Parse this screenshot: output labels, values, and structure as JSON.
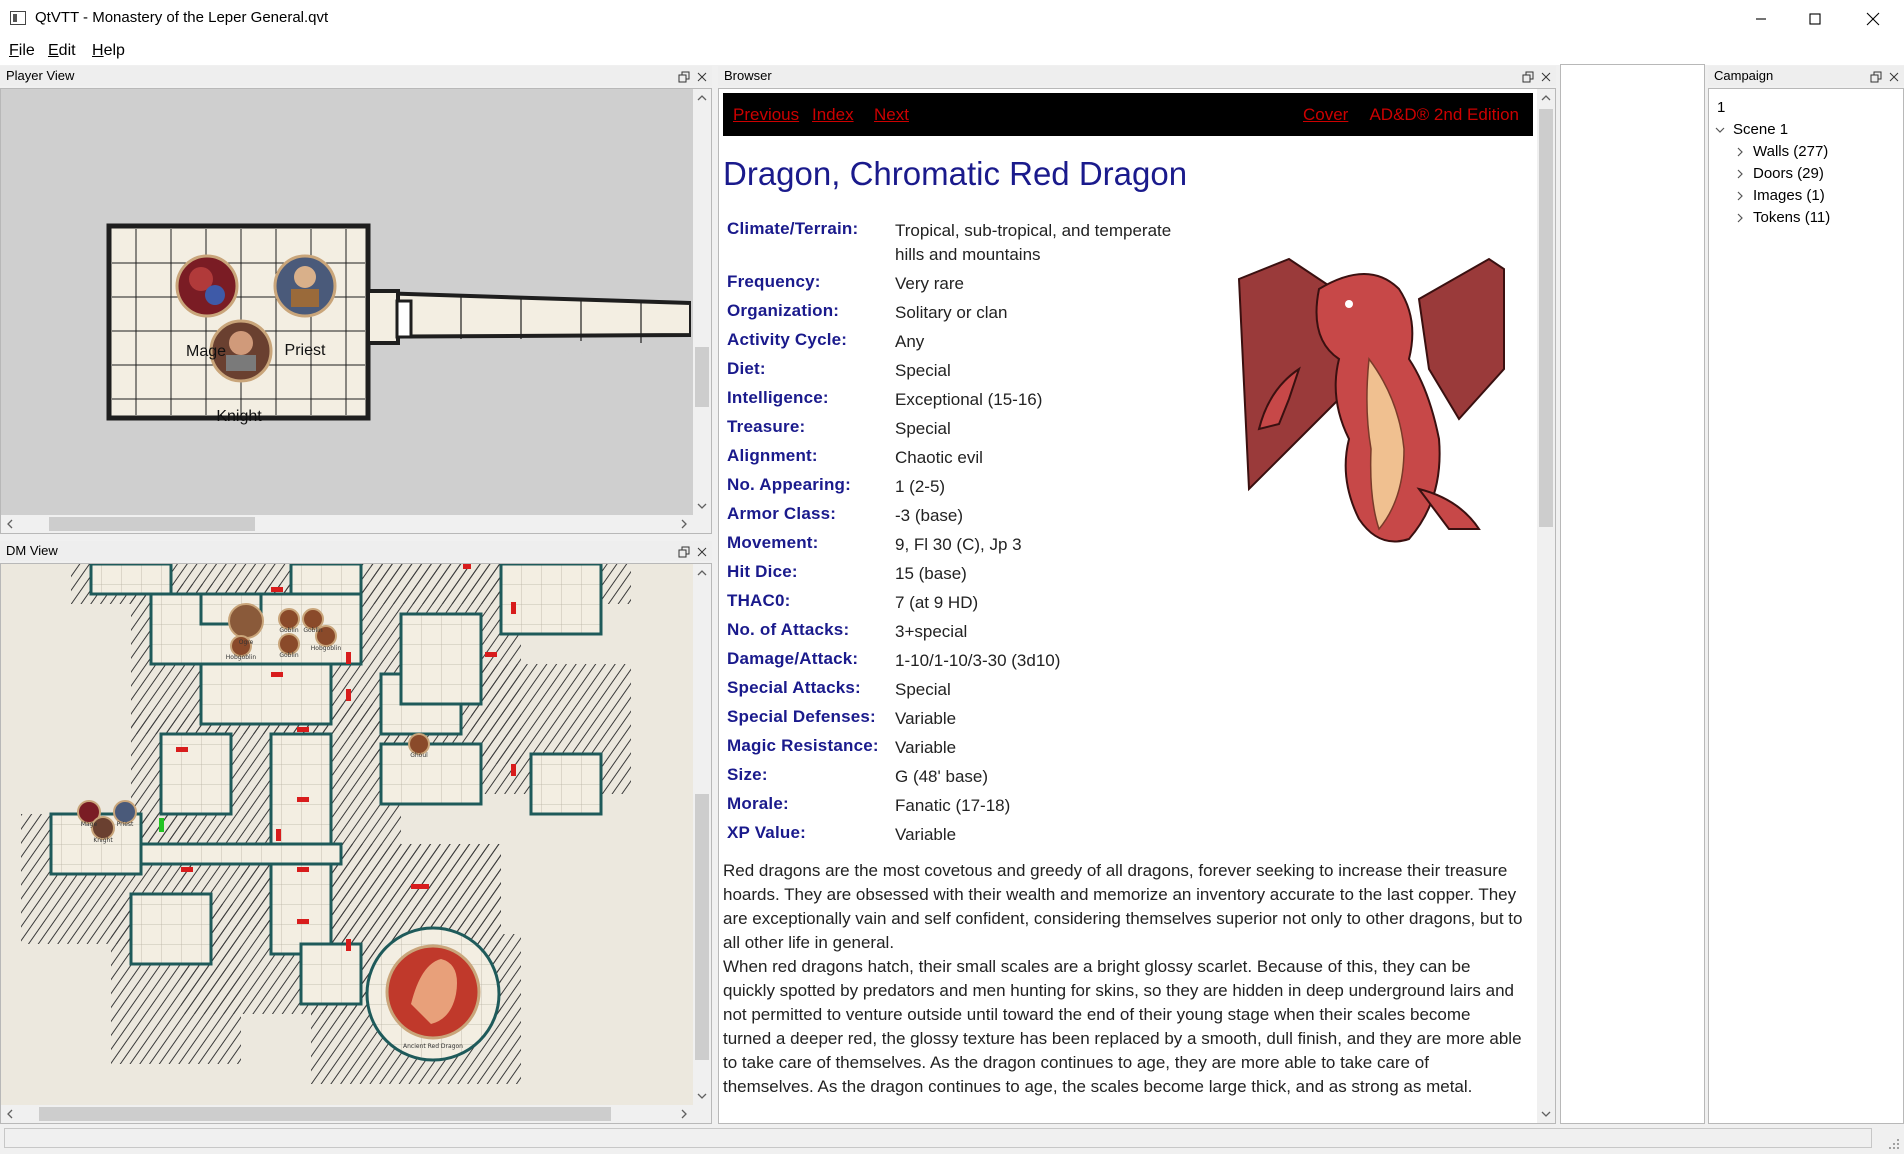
{
  "window": {
    "title": "QtVTT - Monastery of the Leper General.qvt"
  },
  "menu": {
    "file": {
      "accel": "F",
      "rest": "ile"
    },
    "edit": {
      "accel": "E",
      "rest": "dit"
    },
    "help": {
      "accel": "H",
      "rest": "elp"
    }
  },
  "player_view": {
    "title": "Player View",
    "tokens": [
      "Mage",
      "Priest",
      "Knight"
    ]
  },
  "dm_view": {
    "title": "DM View",
    "token_labels": [
      "Ogre",
      "Goblin",
      "Goblin",
      "Hobgoblin",
      "Hobgoblin",
      "Goblin",
      "Ghoul",
      "Mage",
      "Priest",
      "Knight",
      "Ancient Red Dragon"
    ]
  },
  "browser": {
    "title": "Browser",
    "nav": {
      "previous": "Previous",
      "index": "Index",
      "next": "Next",
      "cover": "Cover",
      "edition": "AD&D® 2nd Edition"
    },
    "monster_title": "Dragon, Chromatic Red Dragon",
    "stats": [
      {
        "label": "Climate/Terrain:",
        "value": "Tropical, sub-tropical, and temperate hills and mountains"
      },
      {
        "label": "Frequency:",
        "value": "Very rare"
      },
      {
        "label": "Organization:",
        "value": "Solitary or clan"
      },
      {
        "label": "Activity Cycle:",
        "value": "Any"
      },
      {
        "label": "Diet:",
        "value": "Special"
      },
      {
        "label": "Intelligence:",
        "value": "Exceptional (15-16)"
      },
      {
        "label": "Treasure:",
        "value": "Special"
      },
      {
        "label": "Alignment:",
        "value": "Chaotic evil"
      },
      {
        "label": "No. Appearing:",
        "value": "1 (2-5)"
      },
      {
        "label": "Armor Class:",
        "value": "-3 (base)"
      },
      {
        "label": "Movement:",
        "value": "9, Fl 30 (C), Jp 3"
      },
      {
        "label": "Hit Dice:",
        "value": "15 (base)"
      },
      {
        "label": "THAC0:",
        "value": "7 (at 9 HD)"
      },
      {
        "label": "No. of Attacks:",
        "value": "3+special"
      },
      {
        "label": "Damage/Attack:",
        "value": "1-10/1-10/3-30 (3d10)"
      },
      {
        "label": "Special Attacks:",
        "value": "Special"
      },
      {
        "label": "Special Defenses:",
        "value": "Variable"
      },
      {
        "label": "Magic Resistance:",
        "value": "Variable"
      },
      {
        "label": "Size:",
        "value": "G (48' base)"
      },
      {
        "label": "Morale:",
        "value": "Fanatic (17-18)"
      },
      {
        "label": "XP Value:",
        "value": "Variable"
      }
    ],
    "description": [
      "Red dragons are the most covetous and greedy of all dragons, forever seeking to increase their treasure hoards. They are obsessed with their wealth and memorize an inventory accurate to the last copper. They are exceptionally vain and self confident, considering themselves superior not only to other dragons, but to all other life in general.",
      "When red dragons hatch, their small scales are a bright glossy scarlet. Because of this, they can be quickly spotted by predators and men hunting for skins, so they are hidden in deep underground lairs and not permitted to venture outside until toward the end of their young stage when their scales become turned a deeper red, the glossy texture has been replaced by a smooth, dull finish, and they are more able to take care of themselves. As the dragon continues to age, they are more able to take care of themselves. As the dragon continues to age, the scales become large thick, and as strong as metal."
    ]
  },
  "campaign": {
    "title": "Campaign",
    "root": "1",
    "scene": "Scene 1",
    "children": [
      "Walls (277)",
      "Doors (29)",
      "Images (1)",
      "Tokens (11)"
    ]
  },
  "colors": {
    "title_blue": "#1a1a8c",
    "link_red": "#cc0000",
    "map_floor": "#f3eee2",
    "map_wall": "#1e1e1e",
    "door_red": "#d81c1c"
  }
}
